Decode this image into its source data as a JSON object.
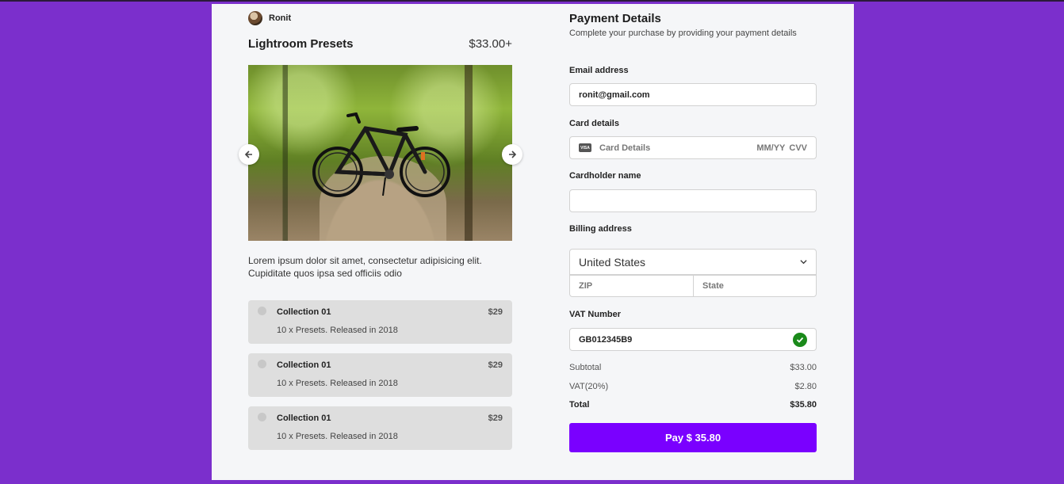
{
  "seller": {
    "name": "Ronit"
  },
  "product": {
    "title": "Lightroom Presets",
    "price": "$33.00+",
    "description": "Lorem ipsum dolor sit amet, consectetur adipisicing elit. Cupiditate quos ipsa sed officiis odio"
  },
  "collections": [
    {
      "title": "Collection 01",
      "subtitle": "10 x Presets. Released in 2018",
      "price": "$29"
    },
    {
      "title": "Collection 01",
      "subtitle": "10 x Presets. Released in 2018",
      "price": "$29"
    },
    {
      "title": "Collection 01",
      "subtitle": "10 x Presets. Released in 2018",
      "price": "$29"
    }
  ],
  "payment": {
    "title": "Payment Details",
    "subtitle": "Complete your purchase by providing your payment details",
    "email_label": "Email address",
    "email_value": "ronit@gmail.com",
    "card_label": "Card details",
    "card_placeholder": "Card Details",
    "card_expiry": "MM/YY",
    "card_cvv": "CVV",
    "card_brand": "VISA",
    "cardholder_label": "Cardholder name",
    "cardholder_value": "",
    "billing_label": "Billing address",
    "country": "United States",
    "zip_placeholder": "ZIP",
    "state_placeholder": "State",
    "vat_label": "VAT Number",
    "vat_value": "GB012345B9"
  },
  "summary": {
    "subtotal_label": "Subtotal",
    "subtotal": "$33.00",
    "vat_label": "VAT(20%)",
    "vat": "$2.80",
    "total_label": "Total",
    "total": "$35.80"
  },
  "pay_button": "Pay $ 35.80",
  "colors": {
    "page_bg": "#7b2fcc",
    "button": "#7a00ff",
    "check": "#1a8a1a"
  }
}
